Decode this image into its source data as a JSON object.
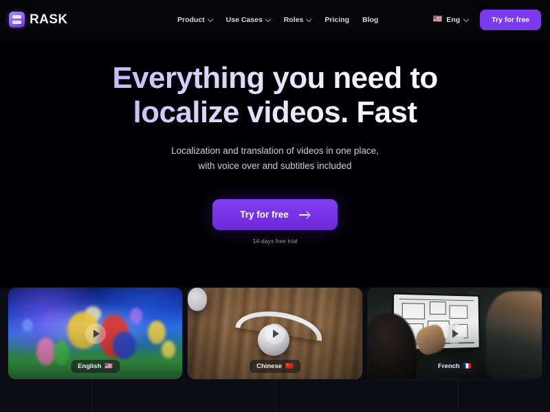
{
  "header": {
    "logo_text": "RASK",
    "logo_icon": "rask-logo-mark",
    "nav": [
      {
        "label": "Product",
        "has_dropdown": true
      },
      {
        "label": "Use Cases",
        "has_dropdown": true
      },
      {
        "label": "Roles",
        "has_dropdown": true
      },
      {
        "label": "Pricing",
        "has_dropdown": false
      },
      {
        "label": "Blog",
        "has_dropdown": false
      }
    ],
    "language": {
      "label": "Eng",
      "flag": "🇺🇸",
      "has_dropdown": true
    },
    "cta_label": "Try for free"
  },
  "hero": {
    "headline_line1": "Everything you need to",
    "headline_line2": "localize videos. Fast",
    "subhead_line1": "Localization and translation of videos in one place,",
    "subhead_line2": "with voice over and subtitles included",
    "cta_label": "Try for free",
    "cta_icon": "arrow-right-icon",
    "trial_note": "14-days free trial"
  },
  "cards": [
    {
      "language": "English",
      "flag": "🇺🇸",
      "art": "game-characters-key-art",
      "play_icon": "play-icon"
    },
    {
      "language": "Chinese",
      "flag": "🇨🇳",
      "art": "white-headphones-on-wooden-table",
      "play_icon": "play-icon"
    },
    {
      "language": "French",
      "flag": "🇫🇷",
      "art": "two-people-reviewing-floorplan-on-monitor",
      "play_icon": "play-icon"
    }
  ],
  "colors": {
    "background": "#000000",
    "accent_purple": "#7c3aed",
    "cta_purple": "#6d28d9",
    "heading_gradient_start": "#b3a4f0",
    "heading_gradient_end": "#ffffff",
    "body_text": "#cfcdd6"
  }
}
